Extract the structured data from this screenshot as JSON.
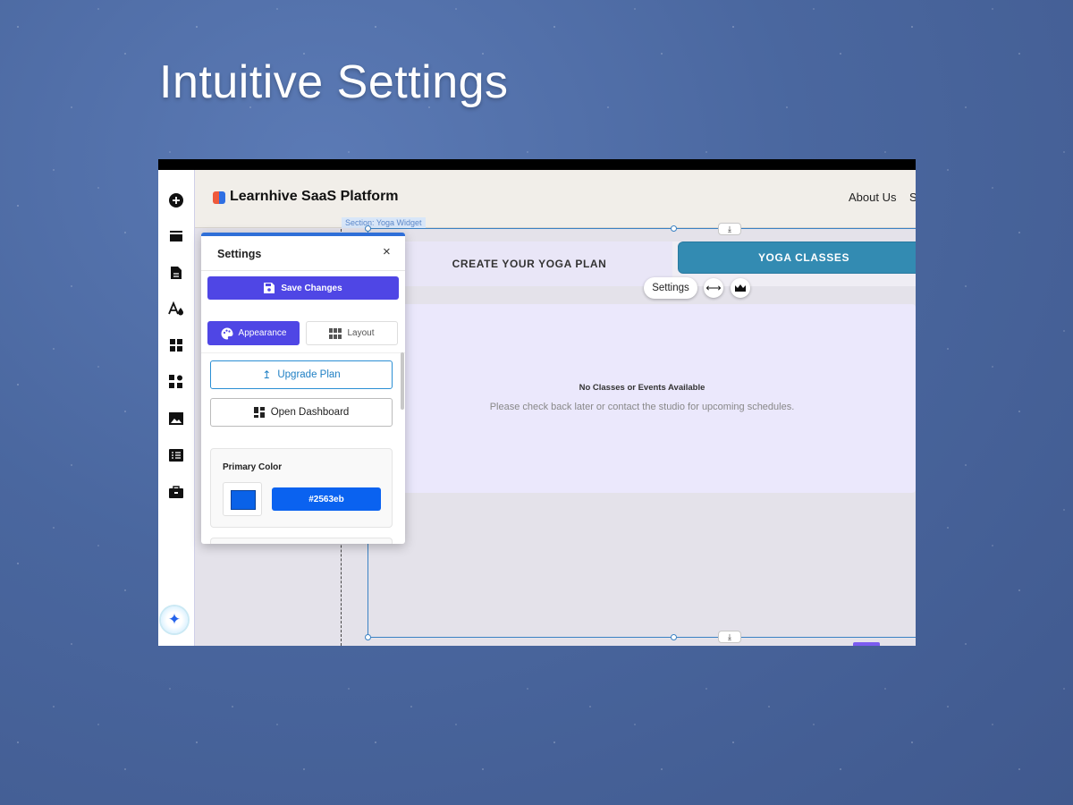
{
  "hero": {
    "title": "Intuitive Settings"
  },
  "site": {
    "brand": "Learnhive SaaS Platform",
    "nav": [
      "About Us",
      "S"
    ],
    "section_tag": "Section: Yoga Widget"
  },
  "tabs": {
    "create": "CREATE YOUR YOGA PLAN",
    "classes": "YOGA CLASSES"
  },
  "floating_toolbar": {
    "settings_label": "Settings"
  },
  "empty_state": {
    "title": "No Classes or Events Available",
    "subtitle": "Please check back later or contact the studio for upcoming schedules."
  },
  "settings_panel": {
    "title": "Settings",
    "close": "×",
    "save_label": "Save Changes",
    "tab_appearance": "Appearance",
    "tab_layout": "Layout",
    "upgrade_label": "Upgrade Plan",
    "dashboard_label": "Open Dashboard",
    "primary_color_label": "Primary Color",
    "primary_color_value": "#2563eb"
  },
  "icons": {
    "rail": [
      "add-icon",
      "sections-icon",
      "pages-icon",
      "theme-icon",
      "apps-icon",
      "plugins-icon",
      "media-icon",
      "cms-icon",
      "business-icon",
      "ai-assistant-icon"
    ]
  }
}
